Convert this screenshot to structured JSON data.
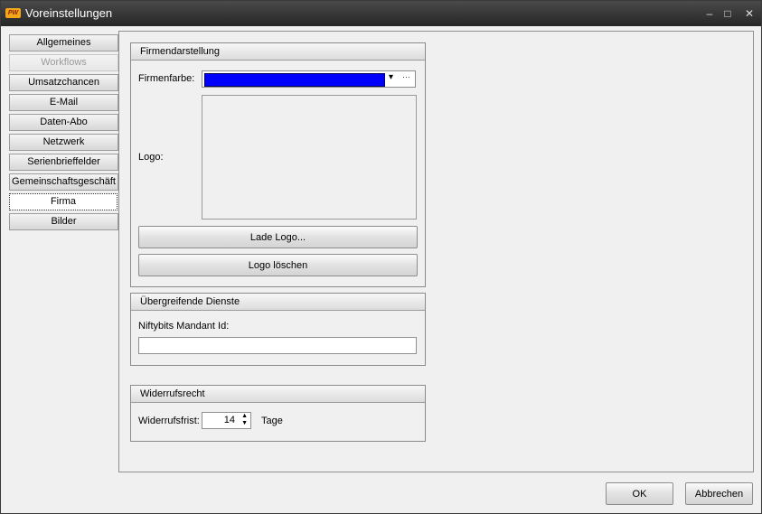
{
  "window": {
    "title": "Voreinstellungen",
    "app_icon_text": "PW",
    "controls": {
      "close": "✕",
      "maximize": "□",
      "minimize": "–"
    }
  },
  "tabs": [
    {
      "label": "Allgemeines",
      "state": "normal"
    },
    {
      "label": "Workflows",
      "state": "disabled"
    },
    {
      "label": "Umsatzchancen",
      "state": "normal"
    },
    {
      "label": "E-Mail",
      "state": "normal"
    },
    {
      "label": "Daten-Abo",
      "state": "normal"
    },
    {
      "label": "Netzwerk",
      "state": "normal"
    },
    {
      "label": "Serienbrieffelder",
      "state": "normal"
    },
    {
      "label": "Gemeinschaftsgeschäft",
      "state": "normal"
    },
    {
      "label": "Firma",
      "state": "active"
    },
    {
      "label": "Bilder",
      "state": "normal"
    }
  ],
  "firmendarstellung": {
    "header": "Firmendarstellung",
    "color_label": "Firmenfarbe:",
    "color_value": "#0000ff",
    "dropdown_glyph": "▾",
    "ellipsis_glyph": "···",
    "logo_label": "Logo:",
    "load_logo_button": "Lade Logo...",
    "delete_logo_button": "Logo löschen"
  },
  "dienste": {
    "header": "Übergreifende Dienste",
    "mandant_label": "Niftybits Mandant Id:",
    "mandant_value": ""
  },
  "widerruf": {
    "header": "Widerrufsrecht",
    "frist_label": "Widerrufsfrist:",
    "frist_value": "14",
    "unit": "Tage"
  },
  "footer": {
    "ok_button": "OK",
    "cancel_button": "Abbrechen"
  }
}
